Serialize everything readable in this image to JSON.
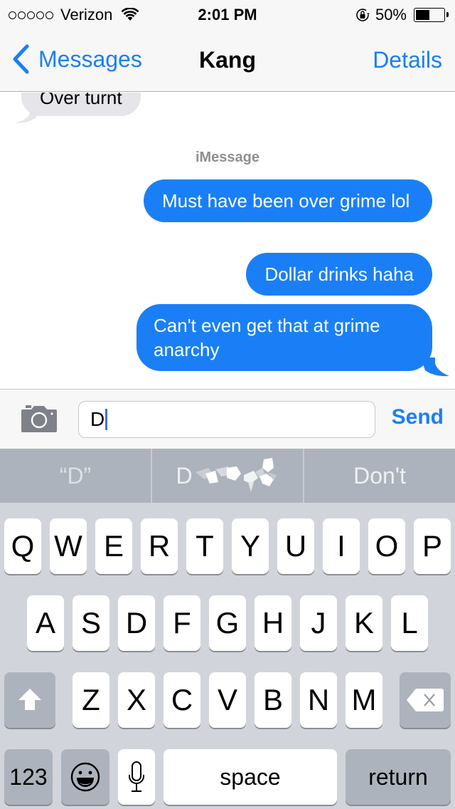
{
  "status_bar": {
    "signal_dots": 5,
    "carrier": "Verizon",
    "wifi_icon": "wifi-icon",
    "time": "2:01 PM",
    "rotation_lock_icon": "rotation-lock-icon",
    "battery_percent_label": "50%",
    "battery_level": 0.5
  },
  "nav": {
    "back_label": "Messages",
    "title": "Kang",
    "details_label": "Details"
  },
  "conversation": {
    "service_label": "iMessage",
    "messages": [
      {
        "direction": "incoming",
        "text": "Over turnt"
      },
      {
        "direction": "outgoing",
        "text": "Must have been over grime lol"
      },
      {
        "direction": "outgoing",
        "text": "Dollar drinks haha"
      },
      {
        "direction": "outgoing",
        "text": "Can't even get that at grime anarchy"
      }
    ]
  },
  "input_bar": {
    "camera_icon": "camera-icon",
    "message_value": "D",
    "send_label": "Send"
  },
  "suggestions": [
    {
      "label": "“D”"
    },
    {
      "label": "D"
    },
    {
      "label": "Don't"
    }
  ],
  "keyboard": {
    "row1": [
      "Q",
      "W",
      "E",
      "R",
      "T",
      "Y",
      "U",
      "I",
      "O",
      "P"
    ],
    "row2": [
      "A",
      "S",
      "D",
      "F",
      "G",
      "H",
      "J",
      "K",
      "L"
    ],
    "row3": [
      "Z",
      "X",
      "C",
      "V",
      "B",
      "N",
      "M"
    ],
    "numbers_label": "123",
    "space_label": "space",
    "return_label": "return",
    "shift_icon": "shift-icon",
    "delete_icon": "delete-icon",
    "emoji_icon": "emoji-icon",
    "mic_icon": "microphone-icon"
  },
  "colors": {
    "accent": "#1a7ff6",
    "incoming_bubble": "#e5e5ea",
    "keyboard_bg": "#d1d5db",
    "dark_key": "#adb3bc"
  }
}
